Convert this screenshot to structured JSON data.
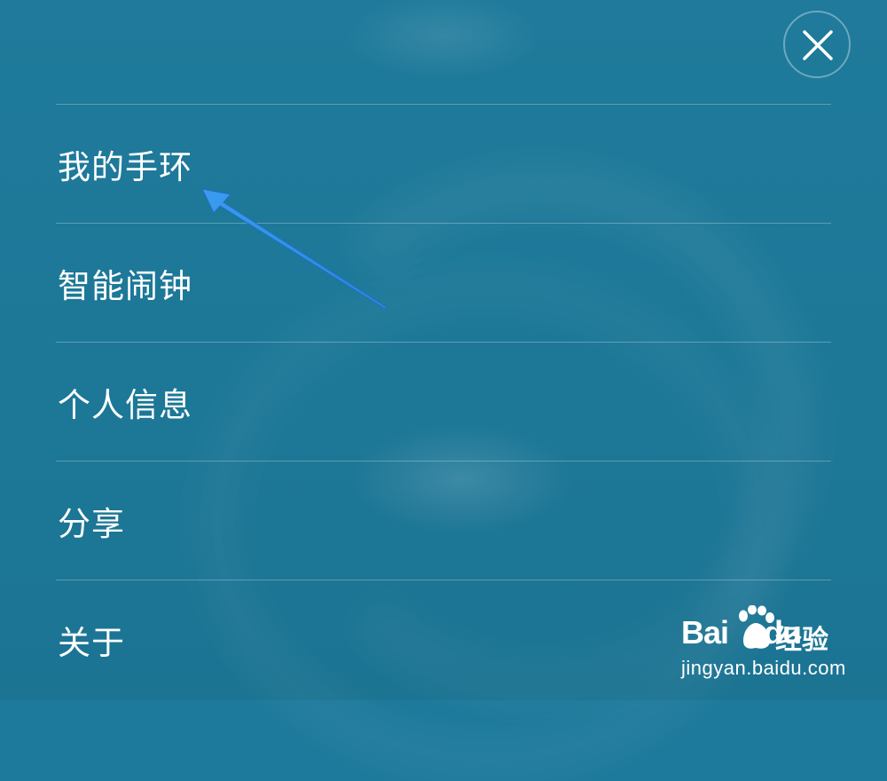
{
  "header": {
    "close_icon": "close-icon"
  },
  "menu": {
    "items": [
      {
        "label": "我的手环"
      },
      {
        "label": "智能闹钟"
      },
      {
        "label": "个人信息"
      },
      {
        "label": "分享"
      },
      {
        "label": "关于"
      }
    ]
  },
  "annotation": {
    "arrow_color": "#2f8fe8",
    "points_to": "我的手环"
  },
  "watermark": {
    "brand_bai": "Bai",
    "brand_du": "du",
    "brand_suffix": "经验",
    "url": "jingyan.baidu.com"
  },
  "colors": {
    "background": "#1e7a9c",
    "text": "#ffffff",
    "divider": "rgba(255,255,255,0.28)"
  }
}
